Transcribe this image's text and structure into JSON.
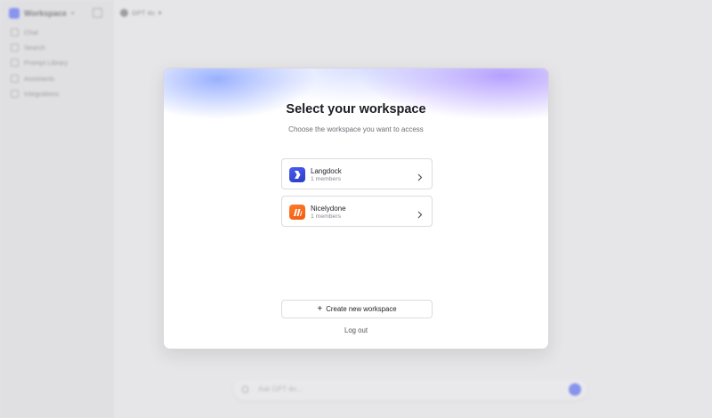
{
  "sidebar": {
    "workspace_name": "Workspace",
    "items": [
      {
        "label": "Chat",
        "icon": "chat-icon"
      },
      {
        "label": "Search",
        "icon": "search-icon"
      },
      {
        "label": "Prompt Library",
        "icon": "library-icon"
      },
      {
        "label": "Assistants",
        "icon": "assistant-icon"
      },
      {
        "label": "Integrations",
        "icon": "integrations-icon"
      }
    ]
  },
  "header": {
    "model_label": "GPT 4o"
  },
  "composer": {
    "placeholder": "Ask GPT 4o..."
  },
  "modal": {
    "title": "Select your workspace",
    "subtitle": "Choose the workspace you want to access",
    "workspaces": [
      {
        "name": "Langdock",
        "members": "1 members",
        "logo_color": "#3b4ee6"
      },
      {
        "name": "Nicelydone",
        "members": "1 members",
        "logo_color": "#f7631a"
      }
    ],
    "create_label": "Create new workspace",
    "logout_label": "Log out"
  },
  "colors": {
    "accent": "#5a6cf3",
    "brand_orange": "#f7631a"
  }
}
